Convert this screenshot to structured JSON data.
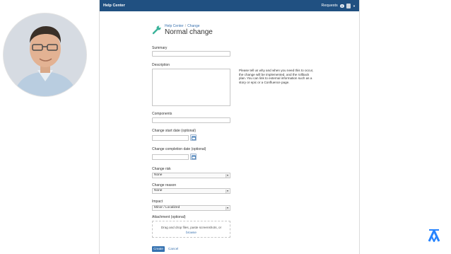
{
  "app": {
    "brand": "Help Center"
  },
  "topbar": {
    "requests_label": "Requests",
    "requests_count": "0"
  },
  "breadcrumb": {
    "root": "Help Center",
    "separator": "/",
    "current": "Change"
  },
  "page": {
    "title": "Normal change"
  },
  "form": {
    "summary_label": "Summary",
    "description_label": "Description",
    "description_help": "Please tell us why and when you need this to occur, the change will be implemented, and the rollback plan. You can link to external information such as a story or epic or a Confluence page.",
    "components_label": "Components",
    "start_date_label": "Change start date (optional)",
    "completion_date_label": "Change completion date (optional)",
    "risk_label": "Change risk",
    "risk_value": "None",
    "reason_label": "Change reason",
    "reason_value": "None",
    "impact_label": "Impact",
    "impact_value": "Minor / Localized",
    "attachment_label": "Attachment (optional)",
    "attachment_hint": "Drag and drop files, paste screenshots, or",
    "attachment_browse": "browse",
    "create_label": "Create",
    "cancel_label": "Cancel"
  },
  "icons": {
    "wrench": "wrench-icon",
    "calendar": "calendar-icon",
    "logo": "atlassian-logo"
  },
  "colors": {
    "topbar": "#205081",
    "link": "#3b73af",
    "primary_button": "#3572b0",
    "logo": "#2684ff"
  }
}
